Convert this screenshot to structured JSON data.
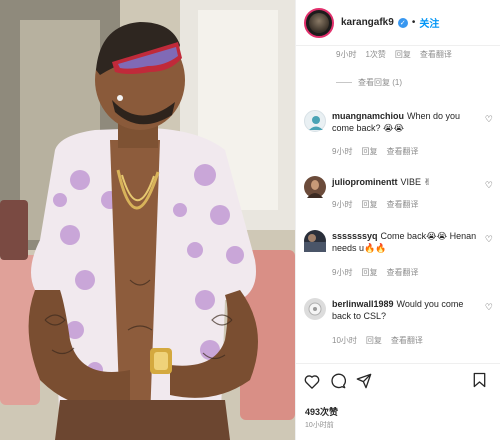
{
  "post": {
    "username": "karangafk9",
    "separator": "•",
    "follow_label": "关注",
    "likes_label": "493次赞",
    "posted_time": "10小时前"
  },
  "first_meta": {
    "time": "9小时",
    "likes": "1次赞",
    "reply": "回复",
    "translate": "查看翻译"
  },
  "view_replies_label": "查看回复 (1)",
  "comments": [
    {
      "username": "muangnamchiou",
      "text": "When do you come back? 😭😭",
      "time": "9小时",
      "reply": "回复",
      "translate": "查看翻译",
      "avatar_color": "#e9f0f3"
    },
    {
      "username": "julioprominentt",
      "text": "VIBE ✌",
      "time": "9小时",
      "reply": "回复",
      "translate": "查看翻译",
      "avatar_color": "#6b4b3a"
    },
    {
      "username": "sssssssyq",
      "text": "Come back😭😭 Henan needs u🔥🔥",
      "time": "9小时",
      "reply": "回复",
      "translate": "查看翻译",
      "avatar_color": "#2a2f3a"
    },
    {
      "username": "berlinwall1989",
      "text": "Would you come back to CSL?",
      "time": "10小时",
      "reply": "回复",
      "translate": "查看翻译",
      "avatar_color": "#dcdcdc"
    }
  ],
  "icons": [
    "heart-icon",
    "comment-icon",
    "share-icon",
    "bookmark-icon",
    "verified-badge-icon"
  ],
  "colors": {
    "accent": "#0095f6",
    "verified": "#3897f0",
    "muted": "#8e8e8e"
  }
}
